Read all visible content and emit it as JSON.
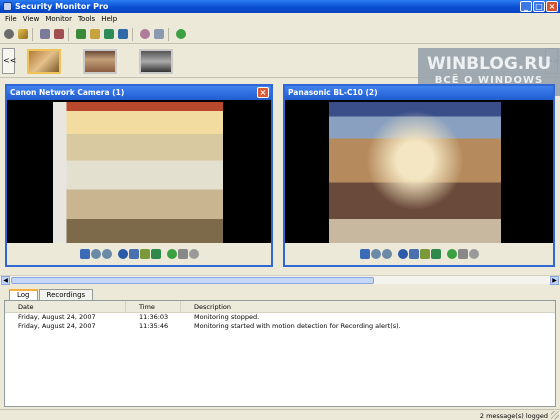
{
  "window": {
    "title": "Security Monitor Pro"
  },
  "menu": [
    "File",
    "View",
    "Monitor",
    "Tools",
    "Help"
  ],
  "toolbar_icons": [
    "user-icon",
    "wand-icon",
    "add-camera-icon",
    "remove-camera-icon",
    "record-icon",
    "snapshot-icon",
    "grid-icon",
    "monitor-icon",
    "settings-icon",
    "log-icon",
    "web-icon"
  ],
  "thumbnail_strip": {
    "prev_label": "<<",
    "next_label": ">>"
  },
  "watermark": {
    "line1": "WINBLOG.RU",
    "line2": "ВСЁ О WINDOWS"
  },
  "cameras": [
    {
      "title": "Canon Network Camera (1)"
    },
    {
      "title": "Panasonic BL-C10 (2)"
    }
  ],
  "tabs": [
    "Log",
    "Recordings"
  ],
  "log": {
    "columns": [
      "Date",
      "Time",
      "Description"
    ],
    "rows": [
      {
        "date": "Friday, August 24, 2007",
        "time": "11:36:03",
        "description": "Monitoring stopped."
      },
      {
        "date": "Friday, August 24, 2007",
        "time": "11:35:46",
        "description": "Monitoring started with motion detection for Recording alert(s)."
      }
    ]
  },
  "status": {
    "message": "2 message(s) logged"
  },
  "colors": {
    "titlebar": "#0a4fd1",
    "camera_border": "#3067d4",
    "close": "#d8512f"
  }
}
